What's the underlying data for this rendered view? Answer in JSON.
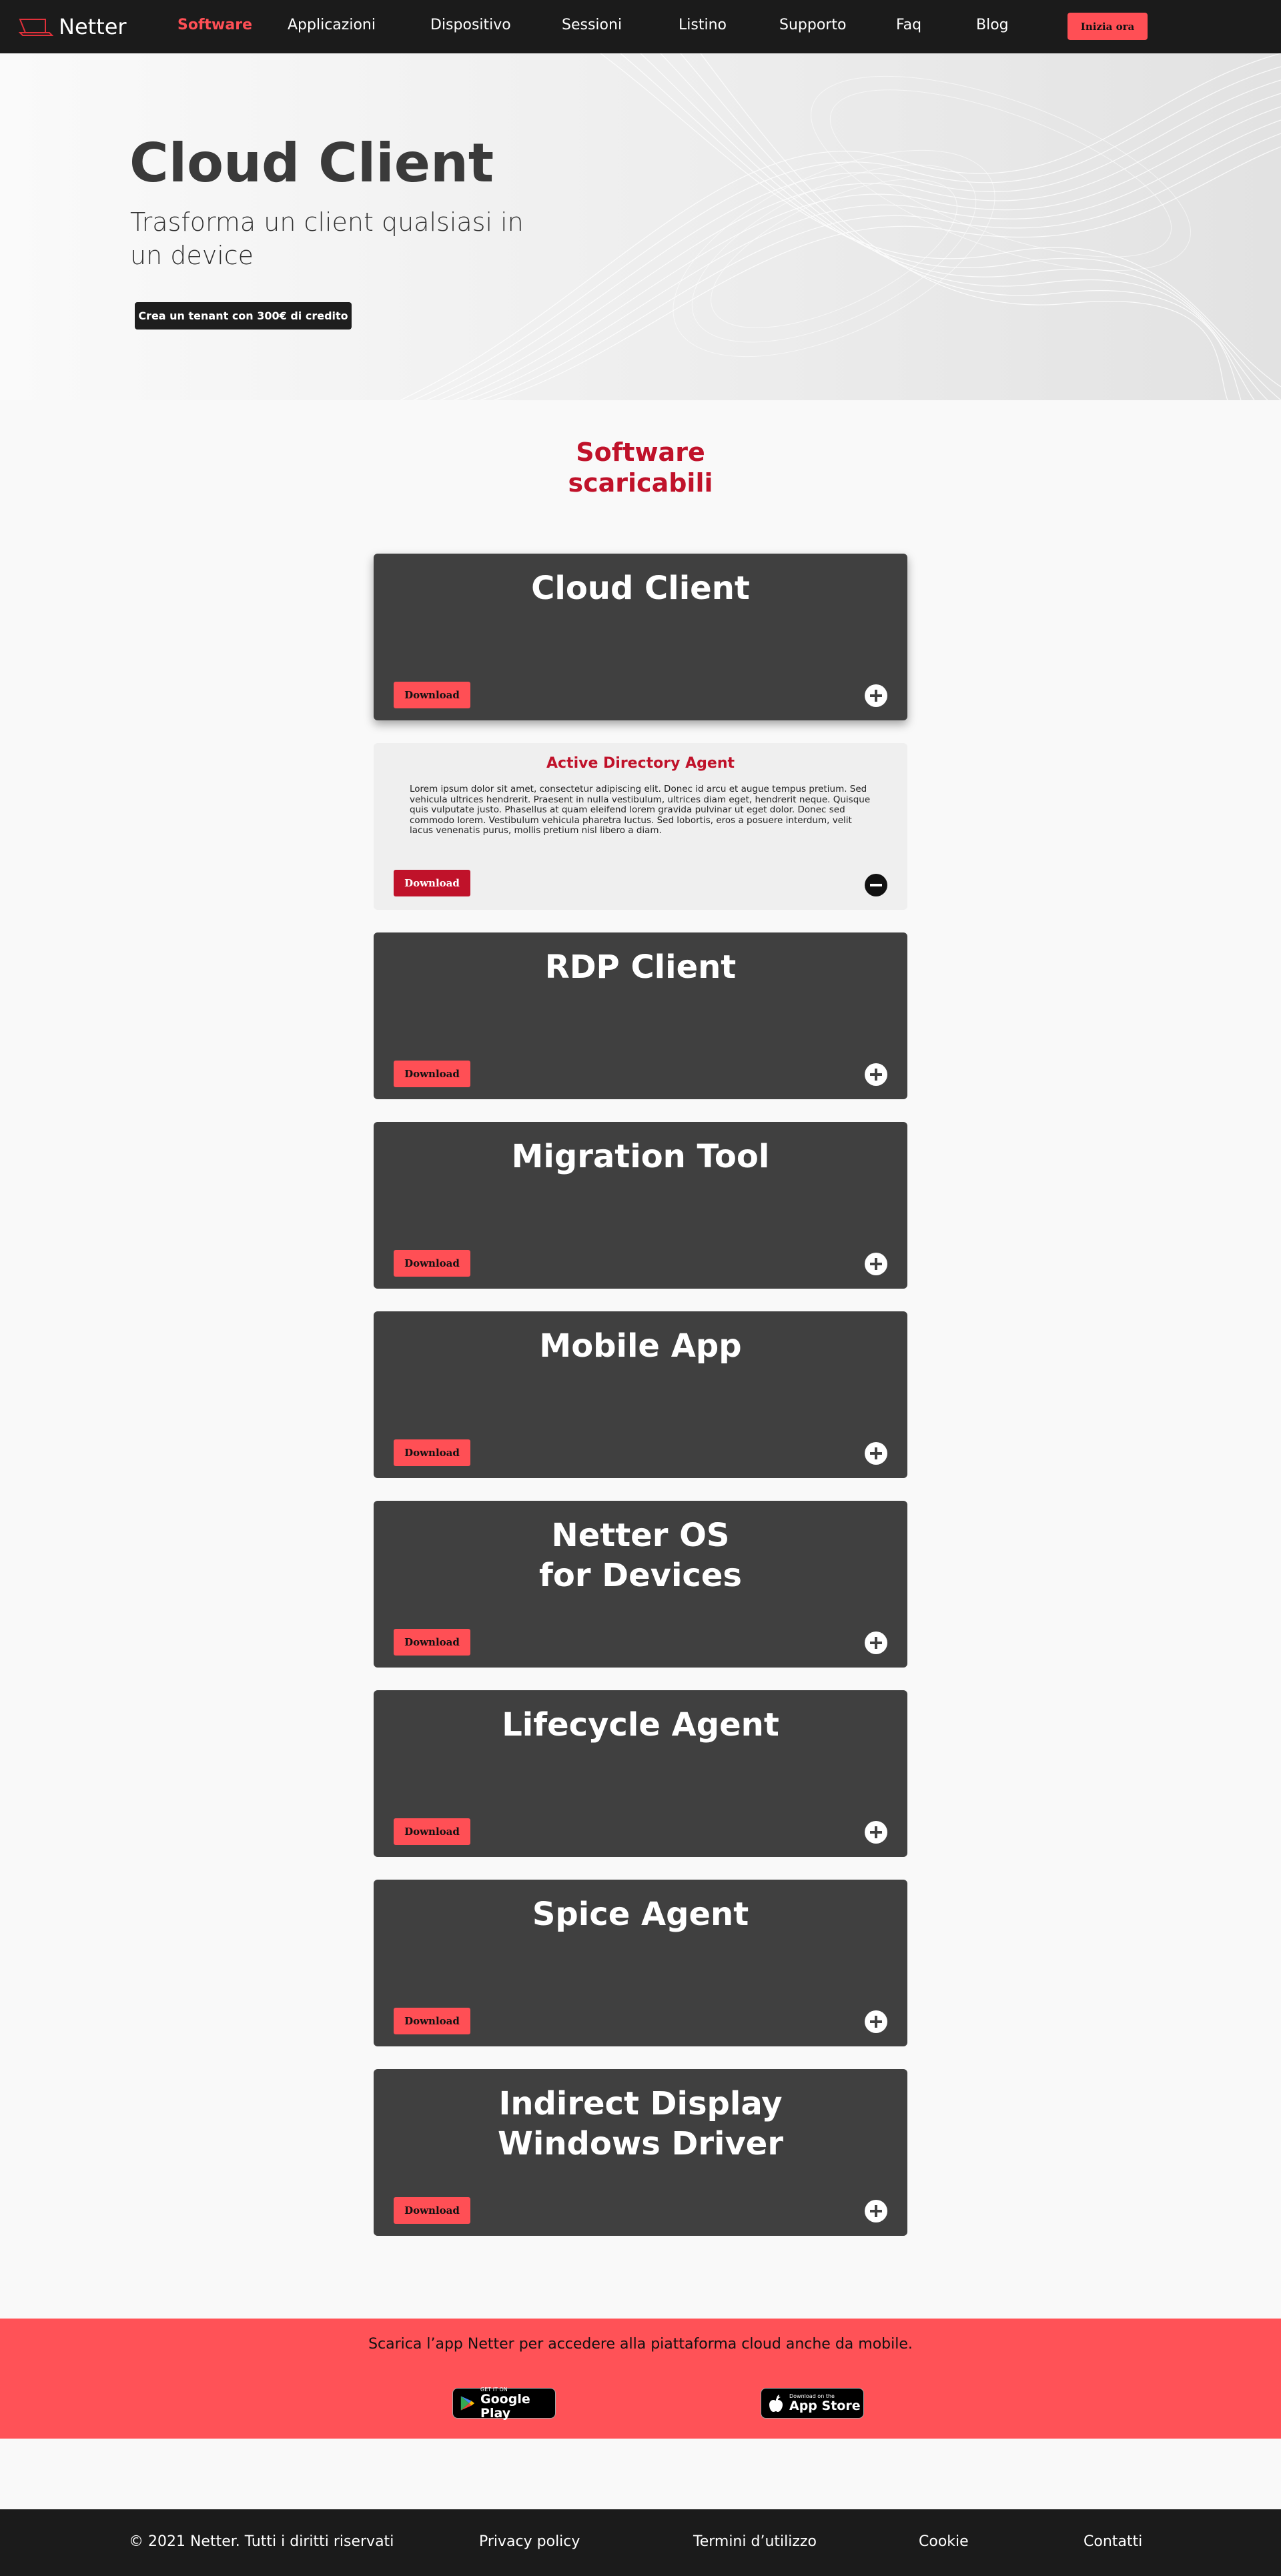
{
  "nav": {
    "brand": "Netter",
    "items": [
      {
        "label": "Software",
        "active": true
      },
      {
        "label": "Applicazioni"
      },
      {
        "label": "Dispositivo"
      },
      {
        "label": "Sessioni"
      },
      {
        "label": "Listino"
      },
      {
        "label": "Supporto"
      },
      {
        "label": "Faq"
      },
      {
        "label": "Blog"
      }
    ],
    "cta": "Inizia ora"
  },
  "hero": {
    "title": "Cloud Client",
    "subtitle": "Trasforma un client qualsiasi in un device",
    "button": "Crea un tenant con 300€ di credito"
  },
  "section": {
    "title_line1": "Software",
    "title_line2": "scaricabili"
  },
  "cards": [
    {
      "title": "Cloud Client",
      "download": "Download"
    },
    {
      "title": "Active Directory Agent",
      "download": "Download",
      "expanded": true,
      "description": "Lorem ipsum dolor sit amet, consectetur adipiscing elit. Donec id arcu et augue tempus pretium. Sed vehicula ultrices hendrerit. Praesent in nulla vestibulum, ultrices diam eget, hendrerit neque. Quisque quis vulputate justo. Phasellus at quam eleifend lorem gravida pulvinar ut eget dolor. Donec sed commodo lorem. Vestibulum vehicula pharetra luctus. Sed lobortis, eros a posuere interdum, velit lacus venenatis purus, mollis pretium nisl libero a diam."
    },
    {
      "title": "RDP Client",
      "download": "Download"
    },
    {
      "title": "Migration Tool",
      "download": "Download"
    },
    {
      "title": "Mobile App",
      "download": "Download"
    },
    {
      "title_line1": "Netter OS",
      "title_line2": "for Devices",
      "download": "Download"
    },
    {
      "title": "Lifecycle Agent",
      "download": "Download"
    },
    {
      "title": "Spice Agent",
      "download": "Download"
    },
    {
      "title_line1": "Indirect Display",
      "title_line2": "Windows Driver",
      "download": "Download"
    }
  ],
  "app_banner": {
    "text": "Scarica l’app Netter per accedere alla piattaforma cloud anche da mobile.",
    "google_small": "GET IT ON",
    "google_big": "Google Play",
    "apple_small": "Download on the",
    "apple_big": "App Store"
  },
  "footer": {
    "copyright": "© 2021 Netter. Tutti i diritti riservati",
    "privacy": "Privacy policy",
    "terms": "Termini d’utilizzo",
    "cookie": "Cookie",
    "contacts": "Contatti"
  },
  "colors": {
    "accent": "#ff4f55",
    "accent_dark": "#c0122a",
    "nav_bg": "#1b1b1b",
    "card_bg": "#404040"
  }
}
